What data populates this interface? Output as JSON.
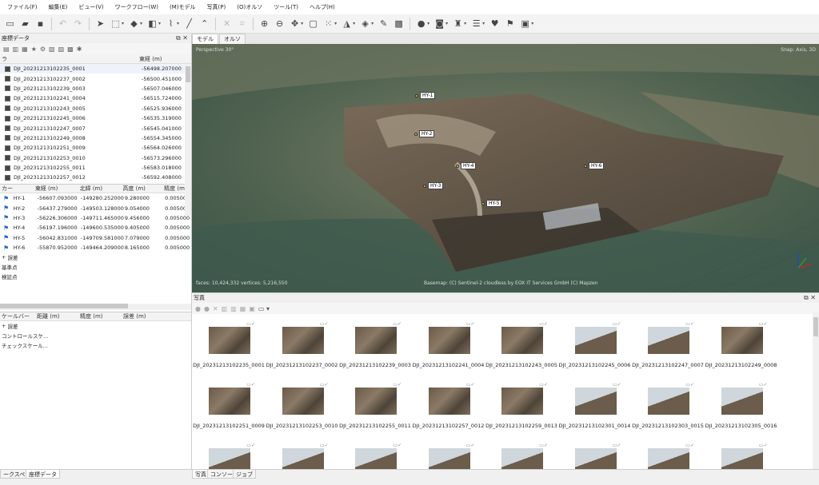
{
  "menu": [
    "ファイル(F)",
    "編集(E)",
    "ビュー(V)",
    "ワークフロー(W)",
    "(M)モデル",
    "写真(P)",
    "(O)オルソ",
    "ツール(T)",
    "ヘルプ(H)"
  ],
  "panel_title": "座標データ",
  "cameras": {
    "col_label": "ラ",
    "col_east": "東経 (m)",
    "rows": [
      {
        "label": "DJI_20231213102235_0001",
        "east": "-56498.207000"
      },
      {
        "label": "DJI_20231213102237_0002",
        "east": "-56500.451000"
      },
      {
        "label": "DJI_20231213102239_0003",
        "east": "-56507.046000"
      },
      {
        "label": "DJI_20231213102241_0004",
        "east": "-56515.724000"
      },
      {
        "label": "DJI_20231213102243_0005",
        "east": "-56525.936000"
      },
      {
        "label": "DJI_20231213102245_0006",
        "east": "-56535.319000"
      },
      {
        "label": "DJI_20231213102247_0007",
        "east": "-56545.041000"
      },
      {
        "label": "DJI_20231213102249_0008",
        "east": "-56554.345000"
      },
      {
        "label": "DJI_20231213102251_0009",
        "east": "-56564.026000"
      },
      {
        "label": "DJI_20231213102253_0010",
        "east": "-56573.296000"
      },
      {
        "label": "DJI_20231213102255_0011",
        "east": "-56583.018000"
      },
      {
        "label": "DJI_20231213102257_0012",
        "east": "-56592.408000"
      }
    ]
  },
  "markers": {
    "col_label": "カー",
    "col_east": "東経 (m)",
    "col_north": "北緯 (m)",
    "col_alt": "高度 (m)",
    "col_acc": "精度 (m)",
    "rows": [
      {
        "label": "HY-1",
        "east": "-56607.093000",
        "north": "-149280.252000",
        "alt": "9.280000",
        "acc": "0.005000"
      },
      {
        "label": "HY-2",
        "east": "-56437.279000",
        "north": "-149503.128000",
        "alt": "9.054000",
        "acc": "0.005000"
      },
      {
        "label": "HY-3",
        "east": "-56226.306000",
        "north": "-149711.465000",
        "alt": "9.456000",
        "acc": "0.005000"
      },
      {
        "label": "HY-4",
        "east": "-56197.196000",
        "north": "-149600.535000",
        "alt": "9.405000",
        "acc": "0.005000"
      },
      {
        "label": "HY-5",
        "east": "-56042.831000",
        "north": "-149709.581000",
        "alt": "7.079000",
        "acc": "0.005000"
      },
      {
        "label": "HY-6",
        "east": "-55870.952000",
        "north": "-149464.209000",
        "alt": "8.165000",
        "acc": "0.005000"
      }
    ],
    "tree": [
      "誤差",
      "基準点",
      "検証点"
    ]
  },
  "scalebars": {
    "col_label": "ケールバー",
    "col_dist": "距離 (m)",
    "col_acc": "精度 (m)",
    "col_err": "誤差 (m)",
    "tree": [
      "誤差",
      "コントロールスケ...",
      "チェックスケール..."
    ]
  },
  "bottom_tabs": [
    "ークスペース",
    "座標データ"
  ],
  "view_tabs": [
    "モデル",
    "オルソ"
  ],
  "viewport": {
    "projection": "Perspective 30°",
    "mode": "Snap: Axis, 3D",
    "stats": "faces: 10,424,332 vertices: 5,216,550",
    "basemap": "Basemap: (C) Sentinel-2 cloudless by EOX IT Services GmbH (C) Mapzen",
    "markers": [
      "HY-1",
      "HY-2",
      "HY-4",
      "HY-3",
      "HY-5",
      "HY-6"
    ]
  },
  "photos_title": "写真",
  "photos": [
    "DJI_20231213102235_0001",
    "DJI_20231213102237_0002",
    "DJI_20231213102239_0003",
    "DJI_20231213102241_0004",
    "DJI_20231213102243_0005",
    "DJI_20231213102245_0006",
    "DJI_20231213102247_0007",
    "DJI_20231213102249_0008",
    "DJI_20231213102251_0009",
    "DJI_20231213102253_0010",
    "DJI_20231213102255_0011",
    "DJI_20231213102257_0012",
    "DJI_20231213102259_0013",
    "DJI_20231213102301_0014",
    "DJI_20231213102303_0015",
    "DJI_20231213102305_0016"
  ],
  "photo_tabs": [
    "写真",
    "コンソール",
    "ジョブ"
  ]
}
